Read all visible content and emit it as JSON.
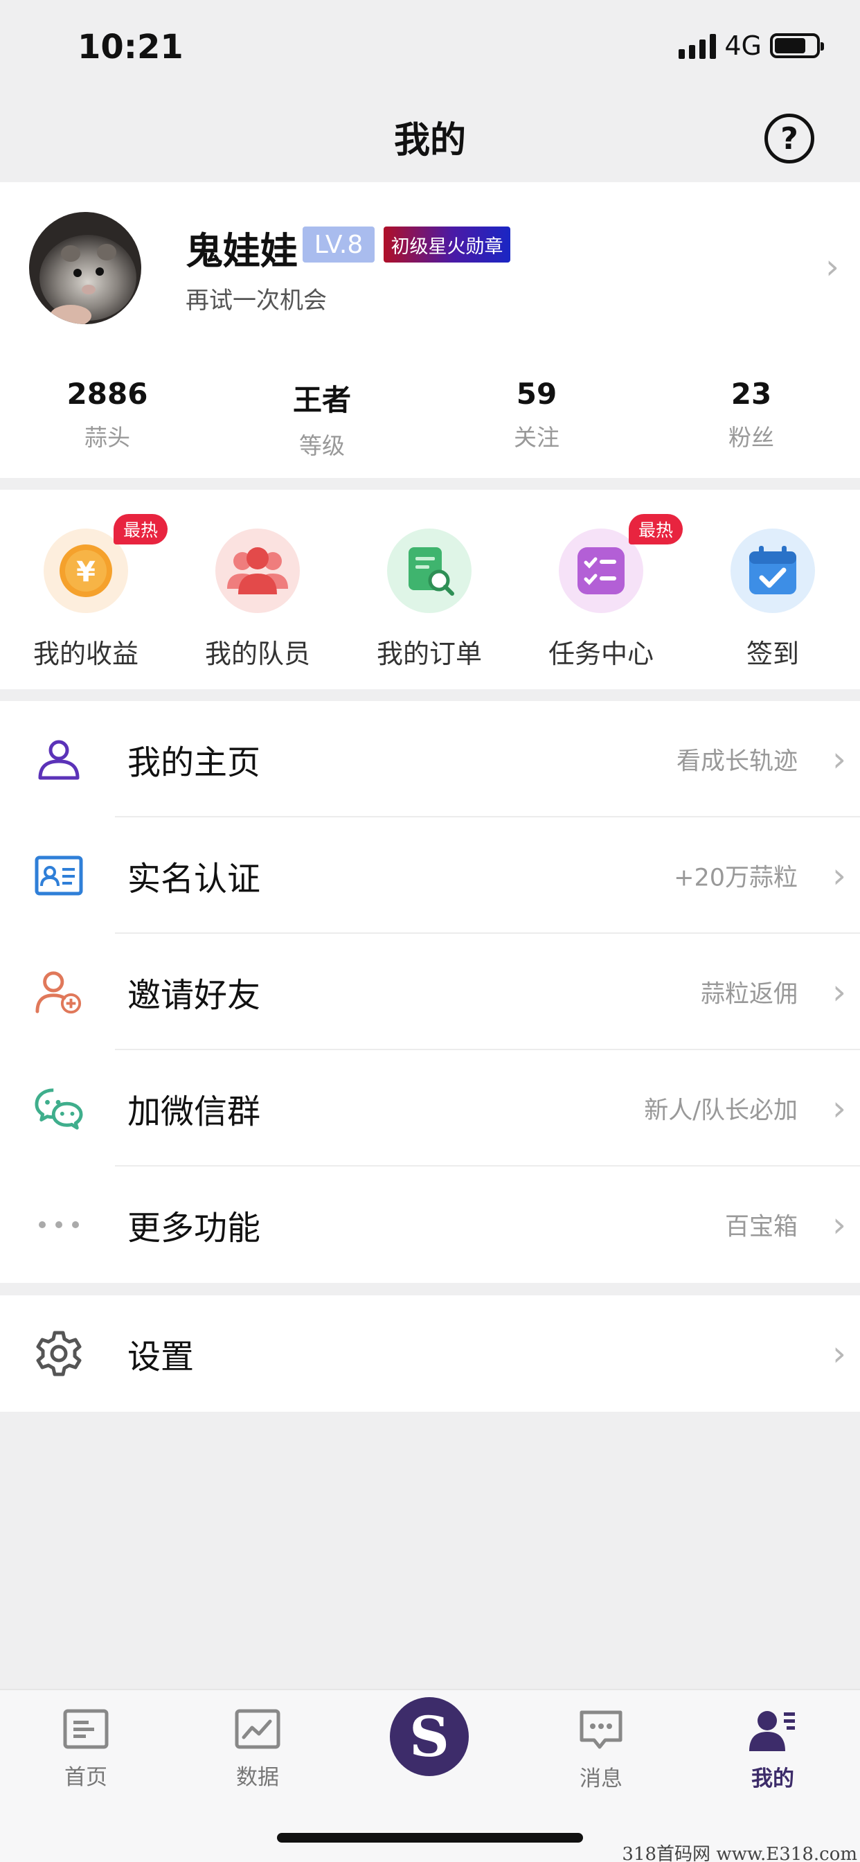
{
  "status_bar": {
    "time": "10:21",
    "network": "4G",
    "battery_level": 0.75
  },
  "header": {
    "title": "我的",
    "help_label": "?"
  },
  "profile": {
    "name": "鬼娃娃",
    "level": "LV.8",
    "medal": "初级星火勋章",
    "signature": "再试一次机会",
    "stats": [
      {
        "value": "2886",
        "label": "蒜头"
      },
      {
        "value": "王者",
        "label": "等级"
      },
      {
        "value": "59",
        "label": "关注"
      },
      {
        "value": "23",
        "label": "粉丝"
      }
    ]
  },
  "shortcuts": [
    {
      "label": "我的收益",
      "icon": "yen-coin-icon",
      "badge": "最热",
      "color": "#f5a12c"
    },
    {
      "label": "我的队员",
      "icon": "team-icon",
      "badge": "",
      "color": "#ea5a5a"
    },
    {
      "label": "我的订单",
      "icon": "order-search-icon",
      "badge": "",
      "color": "#3fb46e"
    },
    {
      "label": "任务中心",
      "icon": "task-list-icon",
      "badge": "最热",
      "color": "#b35fd6"
    },
    {
      "label": "签到",
      "icon": "calendar-check-icon",
      "badge": "",
      "color": "#3d8ee6"
    }
  ],
  "menu": [
    {
      "label": "我的主页",
      "hint": "看成长轨迹",
      "icon": "user-icon"
    },
    {
      "label": "实名认证",
      "hint": "+20万蒜粒",
      "icon": "id-card-icon"
    },
    {
      "label": "邀请好友",
      "hint": "蒜粒返佣",
      "icon": "add-user-icon"
    },
    {
      "label": "加微信群",
      "hint": "新人/队长必加",
      "icon": "wechat-icon"
    },
    {
      "label": "更多功能",
      "hint": "百宝箱",
      "icon": "more-dots-icon"
    }
  ],
  "settings": {
    "label": "设置",
    "icon": "gear-icon"
  },
  "tabbar": [
    {
      "label": "首页",
      "icon": "home-doc-icon",
      "active": false
    },
    {
      "label": "数据",
      "icon": "chart-icon",
      "active": false
    },
    {
      "label": "",
      "icon": "dollar-center-icon",
      "active": false
    },
    {
      "label": "消息",
      "icon": "message-icon",
      "active": false
    },
    {
      "label": "我的",
      "icon": "profile-list-icon",
      "active": true
    }
  ],
  "center_tab_symbol": "S",
  "watermark": "318首码网 www.E318.com",
  "colors": {
    "accent": "#3d2c6a",
    "hot": "#e8243f",
    "level": "#a9bcee"
  }
}
